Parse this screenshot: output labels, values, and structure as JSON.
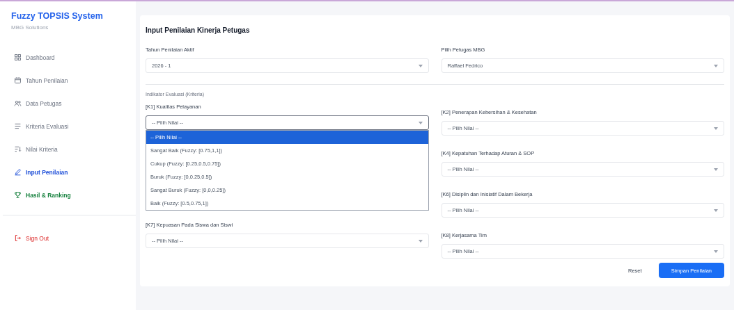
{
  "sidebar": {
    "title": "Fuzzy TOPSIS System",
    "subtitle": "MBG Solutions",
    "items": [
      {
        "label": "Dashboard",
        "selected": false
      },
      {
        "label": "Tahun Penilaian",
        "selected": false
      },
      {
        "label": "Data Petugas",
        "selected": false
      },
      {
        "label": "Kriteria Evaluasi",
        "selected": false
      },
      {
        "label": "Nilai Kriteria",
        "selected": false
      },
      {
        "label": "Input Penilaian",
        "selected": true
      },
      {
        "label": "Hasil & Ranking",
        "kind": "success",
        "selected": false
      }
    ],
    "sign_out": {
      "label": "Sign Out"
    }
  },
  "main": {
    "title": "Input Penilaian Kinerja Petugas",
    "fields": [
      {
        "label": "Tahun Penilaian Aktif",
        "value": "2026 - 1"
      },
      {
        "label": "Pilih Petugas MBG",
        "value": "Raffael Fedrico"
      }
    ],
    "section": "Indikator Evaluasi (Kriteria)",
    "left_criteria": [
      {
        "label": "[K1] Kualitas Pelayanan",
        "value": "-- Pilih Nilai --",
        "expanded": true
      },
      {
        "label": "[K7] Kepuasan Pada Siswa dan Siswi",
        "value": "-- Pilih Nilai --",
        "expanded": false
      }
    ],
    "dropdown_options": [
      {
        "label": "-- Pilih Nilai --",
        "selected": true
      },
      {
        "label": "Sangat Baik (Fuzzy: [0.75,1,1])",
        "selected": false
      },
      {
        "label": "Cukup (Fuzzy: [0.25,0.5,0.75])",
        "selected": false
      },
      {
        "label": "Buruk (Fuzzy: [0,0.25,0.5])",
        "selected": false
      },
      {
        "label": "Sangat Buruk (Fuzzy: [0,0,0.25])",
        "selected": false
      },
      {
        "label": "Baik (Fuzzy: [0.5,0.75,1])",
        "selected": false
      }
    ],
    "right_criteria": [
      {
        "label": "[K2] Penerapan Kebersihan & Kesehatan",
        "value": "-- Pilih Nilai --",
        "expanded": false
      },
      {
        "label": "[K4] Kepatuhan Terhadap Aturan & SOP",
        "value": "-- Pilih Nilai --",
        "expanded": false
      },
      {
        "label": "[K6] Disiplin dan Inisiatif Dalam Bekerja",
        "value": "-- Pilih Nilai --",
        "expanded": false
      },
      {
        "label": "[K8] Kerjasama Tim",
        "value": "-- Pilih Nilai --",
        "expanded": false
      }
    ],
    "buttons": [
      {
        "label": "Reset",
        "kind": "secondary"
      },
      {
        "label": "Simpan Penilaian",
        "kind": "primary"
      }
    ]
  }
}
